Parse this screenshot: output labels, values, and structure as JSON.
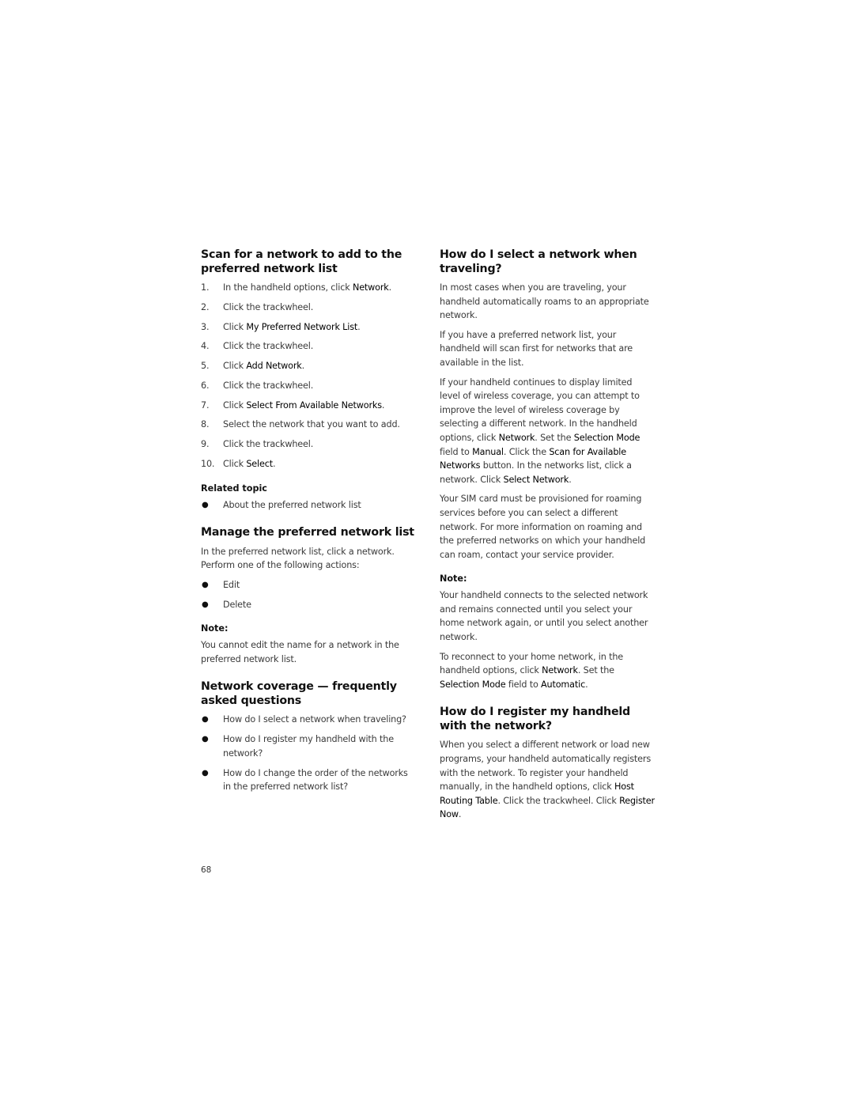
{
  "left_column": {
    "scan_section": {
      "title": "Scan for a network to add to the preferred network list",
      "steps": [
        {
          "num": "1.",
          "segments": [
            {
              "t": "In the handheld options, click ",
              "em": false
            },
            {
              "t": "Network",
              "em": true
            },
            {
              "t": ".",
              "em": false
            }
          ]
        },
        {
          "num": "2.",
          "segments": [
            {
              "t": "Click the trackwheel.",
              "em": false
            }
          ]
        },
        {
          "num": "3.",
          "segments": [
            {
              "t": "Click ",
              "em": false
            },
            {
              "t": "My Preferred Network List",
              "em": true
            },
            {
              "t": ".",
              "em": false
            }
          ]
        },
        {
          "num": "4.",
          "segments": [
            {
              "t": "Click the trackwheel.",
              "em": false
            }
          ]
        },
        {
          "num": "5.",
          "segments": [
            {
              "t": "Click ",
              "em": false
            },
            {
              "t": "Add Network",
              "em": true
            },
            {
              "t": ".",
              "em": false
            }
          ]
        },
        {
          "num": "6.",
          "segments": [
            {
              "t": "Click the trackwheel.",
              "em": false
            }
          ]
        },
        {
          "num": "7.",
          "segments": [
            {
              "t": "Click ",
              "em": false
            },
            {
              "t": "Select From Available Networks",
              "em": true
            },
            {
              "t": ".",
              "em": false
            }
          ]
        },
        {
          "num": "8.",
          "segments": [
            {
              "t": "Select the network that you want to add.",
              "em": false
            }
          ]
        },
        {
          "num": "9.",
          "segments": [
            {
              "t": "Click the trackwheel.",
              "em": false
            }
          ]
        },
        {
          "num": "10.",
          "segments": [
            {
              "t": "Click ",
              "em": false
            },
            {
              "t": "Select",
              "em": true
            },
            {
              "t": ".",
              "em": false
            }
          ]
        }
      ],
      "related_label": "Related topic",
      "related_items": [
        "About the preferred network list"
      ]
    },
    "manage_section": {
      "title": "Manage the preferred network list",
      "intro": "In the preferred network list, click a network. Perform one of the following actions:",
      "actions": [
        "Edit",
        "Delete"
      ],
      "note_label": "Note:",
      "note_text": "You cannot edit the name for a network in the preferred network list."
    },
    "faq_section": {
      "title": "Network coverage — frequently asked questions",
      "items": [
        "How do I select a network when traveling?",
        "How do I register my handheld with the network?",
        "How do I change the order of the networks in the preferred network list?"
      ]
    }
  },
  "right_column": {
    "select_section": {
      "title": "How do I select a network when traveling?",
      "paragraphs": [
        [
          {
            "t": "In most cases when you are traveling, your handheld automatically roams to an appropriate network.",
            "em": false
          }
        ],
        [
          {
            "t": "If you have a preferred network list, your handheld will scan first for networks that are available in the list.",
            "em": false
          }
        ],
        [
          {
            "t": "If your handheld continues to display limited level of wireless coverage, you can attempt to improve the level of wireless coverage by selecting a different network. In the handheld options, click ",
            "em": false
          },
          {
            "t": "Network",
            "em": true
          },
          {
            "t": ". Set the ",
            "em": false
          },
          {
            "t": "Selection Mode",
            "em": true
          },
          {
            "t": " field to ",
            "em": false
          },
          {
            "t": "Manual",
            "em": true
          },
          {
            "t": ". Click the ",
            "em": false
          },
          {
            "t": "Scan for Available Networks",
            "em": true
          },
          {
            "t": " button. In the networks list, click a network. Click ",
            "em": false
          },
          {
            "t": "Select Network",
            "em": true
          },
          {
            "t": ".",
            "em": false
          }
        ],
        [
          {
            "t": "Your SIM card must be provisioned for roaming services before you can select a different network. For more information on roaming and the preferred networks on which your handheld can roam, contact your service provider.",
            "em": false
          }
        ]
      ],
      "note_label": "Note:",
      "note_paragraphs": [
        [
          {
            "t": "Your handheld connects to the selected network and remains connected until you select your home network again, or until you select another network.",
            "em": false
          }
        ],
        [
          {
            "t": "To reconnect to your home network, in the handheld options, click ",
            "em": false
          },
          {
            "t": "Network",
            "em": true
          },
          {
            "t": ". Set the ",
            "em": false
          },
          {
            "t": "Selection Mode",
            "em": true
          },
          {
            "t": " field to ",
            "em": false
          },
          {
            "t": "Automatic",
            "em": true
          },
          {
            "t": ".",
            "em": false
          }
        ]
      ]
    },
    "register_section": {
      "title": "How do I register my handheld with the network?",
      "paragraphs": [
        [
          {
            "t": "When you select a different network or load new programs, your handheld automatically registers with the network. To register your handheld manually, in the handheld options, click ",
            "em": false
          },
          {
            "t": "Host Routing Table",
            "em": true
          },
          {
            "t": ". Click the trackwheel. Click ",
            "em": false
          },
          {
            "t": "Register Now",
            "em": true
          },
          {
            "t": ".",
            "em": false
          }
        ]
      ]
    }
  },
  "footer": {
    "page_number": "68"
  }
}
